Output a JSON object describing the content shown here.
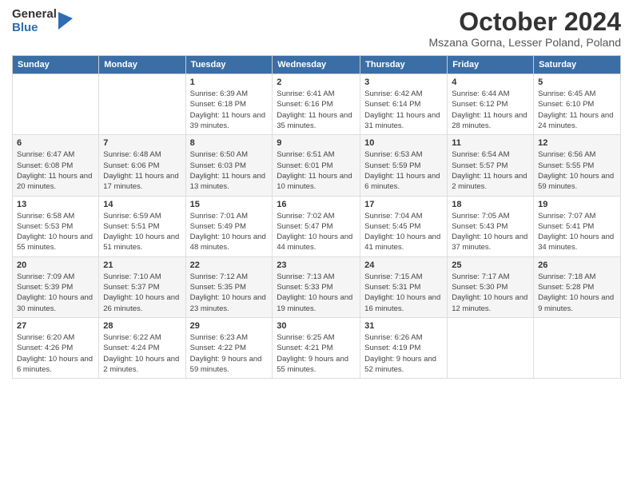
{
  "logo": {
    "general": "General",
    "blue": "Blue"
  },
  "header": {
    "month": "October 2024",
    "location": "Mszana Gorna, Lesser Poland, Poland"
  },
  "weekdays": [
    "Sunday",
    "Monday",
    "Tuesday",
    "Wednesday",
    "Thursday",
    "Friday",
    "Saturday"
  ],
  "weeks": [
    [
      {
        "day": "",
        "sunrise": "",
        "sunset": "",
        "daylight": ""
      },
      {
        "day": "",
        "sunrise": "",
        "sunset": "",
        "daylight": ""
      },
      {
        "day": "1",
        "sunrise": "Sunrise: 6:39 AM",
        "sunset": "Sunset: 6:18 PM",
        "daylight": "Daylight: 11 hours and 39 minutes."
      },
      {
        "day": "2",
        "sunrise": "Sunrise: 6:41 AM",
        "sunset": "Sunset: 6:16 PM",
        "daylight": "Daylight: 11 hours and 35 minutes."
      },
      {
        "day": "3",
        "sunrise": "Sunrise: 6:42 AM",
        "sunset": "Sunset: 6:14 PM",
        "daylight": "Daylight: 11 hours and 31 minutes."
      },
      {
        "day": "4",
        "sunrise": "Sunrise: 6:44 AM",
        "sunset": "Sunset: 6:12 PM",
        "daylight": "Daylight: 11 hours and 28 minutes."
      },
      {
        "day": "5",
        "sunrise": "Sunrise: 6:45 AM",
        "sunset": "Sunset: 6:10 PM",
        "daylight": "Daylight: 11 hours and 24 minutes."
      }
    ],
    [
      {
        "day": "6",
        "sunrise": "Sunrise: 6:47 AM",
        "sunset": "Sunset: 6:08 PM",
        "daylight": "Daylight: 11 hours and 20 minutes."
      },
      {
        "day": "7",
        "sunrise": "Sunrise: 6:48 AM",
        "sunset": "Sunset: 6:06 PM",
        "daylight": "Daylight: 11 hours and 17 minutes."
      },
      {
        "day": "8",
        "sunrise": "Sunrise: 6:50 AM",
        "sunset": "Sunset: 6:03 PM",
        "daylight": "Daylight: 11 hours and 13 minutes."
      },
      {
        "day": "9",
        "sunrise": "Sunrise: 6:51 AM",
        "sunset": "Sunset: 6:01 PM",
        "daylight": "Daylight: 11 hours and 10 minutes."
      },
      {
        "day": "10",
        "sunrise": "Sunrise: 6:53 AM",
        "sunset": "Sunset: 5:59 PM",
        "daylight": "Daylight: 11 hours and 6 minutes."
      },
      {
        "day": "11",
        "sunrise": "Sunrise: 6:54 AM",
        "sunset": "Sunset: 5:57 PM",
        "daylight": "Daylight: 11 hours and 2 minutes."
      },
      {
        "day": "12",
        "sunrise": "Sunrise: 6:56 AM",
        "sunset": "Sunset: 5:55 PM",
        "daylight": "Daylight: 10 hours and 59 minutes."
      }
    ],
    [
      {
        "day": "13",
        "sunrise": "Sunrise: 6:58 AM",
        "sunset": "Sunset: 5:53 PM",
        "daylight": "Daylight: 10 hours and 55 minutes."
      },
      {
        "day": "14",
        "sunrise": "Sunrise: 6:59 AM",
        "sunset": "Sunset: 5:51 PM",
        "daylight": "Daylight: 10 hours and 51 minutes."
      },
      {
        "day": "15",
        "sunrise": "Sunrise: 7:01 AM",
        "sunset": "Sunset: 5:49 PM",
        "daylight": "Daylight: 10 hours and 48 minutes."
      },
      {
        "day": "16",
        "sunrise": "Sunrise: 7:02 AM",
        "sunset": "Sunset: 5:47 PM",
        "daylight": "Daylight: 10 hours and 44 minutes."
      },
      {
        "day": "17",
        "sunrise": "Sunrise: 7:04 AM",
        "sunset": "Sunset: 5:45 PM",
        "daylight": "Daylight: 10 hours and 41 minutes."
      },
      {
        "day": "18",
        "sunrise": "Sunrise: 7:05 AM",
        "sunset": "Sunset: 5:43 PM",
        "daylight": "Daylight: 10 hours and 37 minutes."
      },
      {
        "day": "19",
        "sunrise": "Sunrise: 7:07 AM",
        "sunset": "Sunset: 5:41 PM",
        "daylight": "Daylight: 10 hours and 34 minutes."
      }
    ],
    [
      {
        "day": "20",
        "sunrise": "Sunrise: 7:09 AM",
        "sunset": "Sunset: 5:39 PM",
        "daylight": "Daylight: 10 hours and 30 minutes."
      },
      {
        "day": "21",
        "sunrise": "Sunrise: 7:10 AM",
        "sunset": "Sunset: 5:37 PM",
        "daylight": "Daylight: 10 hours and 26 minutes."
      },
      {
        "day": "22",
        "sunrise": "Sunrise: 7:12 AM",
        "sunset": "Sunset: 5:35 PM",
        "daylight": "Daylight: 10 hours and 23 minutes."
      },
      {
        "day": "23",
        "sunrise": "Sunrise: 7:13 AM",
        "sunset": "Sunset: 5:33 PM",
        "daylight": "Daylight: 10 hours and 19 minutes."
      },
      {
        "day": "24",
        "sunrise": "Sunrise: 7:15 AM",
        "sunset": "Sunset: 5:31 PM",
        "daylight": "Daylight: 10 hours and 16 minutes."
      },
      {
        "day": "25",
        "sunrise": "Sunrise: 7:17 AM",
        "sunset": "Sunset: 5:30 PM",
        "daylight": "Daylight: 10 hours and 12 minutes."
      },
      {
        "day": "26",
        "sunrise": "Sunrise: 7:18 AM",
        "sunset": "Sunset: 5:28 PM",
        "daylight": "Daylight: 10 hours and 9 minutes."
      }
    ],
    [
      {
        "day": "27",
        "sunrise": "Sunrise: 6:20 AM",
        "sunset": "Sunset: 4:26 PM",
        "daylight": "Daylight: 10 hours and 6 minutes."
      },
      {
        "day": "28",
        "sunrise": "Sunrise: 6:22 AM",
        "sunset": "Sunset: 4:24 PM",
        "daylight": "Daylight: 10 hours and 2 minutes."
      },
      {
        "day": "29",
        "sunrise": "Sunrise: 6:23 AM",
        "sunset": "Sunset: 4:22 PM",
        "daylight": "Daylight: 9 hours and 59 minutes."
      },
      {
        "day": "30",
        "sunrise": "Sunrise: 6:25 AM",
        "sunset": "Sunset: 4:21 PM",
        "daylight": "Daylight: 9 hours and 55 minutes."
      },
      {
        "day": "31",
        "sunrise": "Sunrise: 6:26 AM",
        "sunset": "Sunset: 4:19 PM",
        "daylight": "Daylight: 9 hours and 52 minutes."
      },
      {
        "day": "",
        "sunrise": "",
        "sunset": "",
        "daylight": ""
      },
      {
        "day": "",
        "sunrise": "",
        "sunset": "",
        "daylight": ""
      }
    ]
  ]
}
